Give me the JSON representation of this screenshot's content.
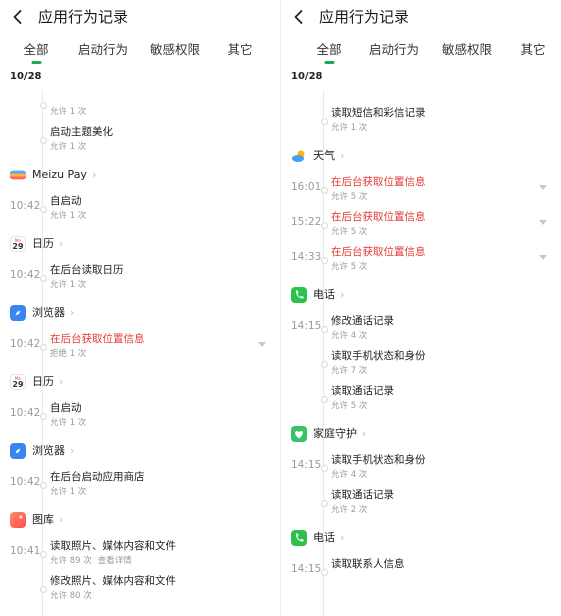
{
  "icons": {
    "back": "back-arrow-icon",
    "expand": "chevron-down-icon",
    "app_chevron": "chevron-right-icon"
  },
  "colors": {
    "accent": "#1aaa55",
    "warning": "#e53935",
    "secondary_text": "#9a9a9a"
  },
  "left": {
    "title": "应用行为记录",
    "tabs": [
      "全部",
      "启动行为",
      "敏感权限",
      "其它"
    ],
    "active_tab": 0,
    "date": "10/28",
    "rows": [
      {
        "kind": "entry",
        "time": "",
        "name": "",
        "sub": "允许 1 次",
        "red": false,
        "expand": false
      },
      {
        "kind": "entry",
        "time": "",
        "name": "启动主题美化",
        "sub": "允许 1 次",
        "red": false,
        "expand": false
      },
      {
        "kind": "app",
        "name": "Meizu Pay",
        "icon": "meizu-pay-icon"
      },
      {
        "kind": "entry",
        "time": "10:42",
        "name": "自启动",
        "sub": "允许 1 次",
        "red": false,
        "expand": false
      },
      {
        "kind": "app",
        "name": "日历",
        "icon": "calendar-icon",
        "cal_day": "29",
        "cal_label": "Mo"
      },
      {
        "kind": "entry",
        "time": "10:42",
        "name": "在后台读取日历",
        "sub": "允许 1 次",
        "red": false,
        "expand": false
      },
      {
        "kind": "app",
        "name": "浏览器",
        "icon": "browser-icon"
      },
      {
        "kind": "entry",
        "time": "10:42",
        "name": "在后台获取位置信息",
        "sub": "拒绝 1 次",
        "red": true,
        "expand": true
      },
      {
        "kind": "app",
        "name": "日历",
        "icon": "calendar-icon",
        "cal_day": "29",
        "cal_label": "Mo"
      },
      {
        "kind": "entry",
        "time": "10:42",
        "name": "自启动",
        "sub": "允许 1 次",
        "red": false,
        "expand": false
      },
      {
        "kind": "app",
        "name": "浏览器",
        "icon": "browser-icon"
      },
      {
        "kind": "entry",
        "time": "10:42",
        "name": "在后台启动应用商店",
        "sub": "允许 1 次",
        "red": false,
        "expand": false
      },
      {
        "kind": "app",
        "name": "图库",
        "icon": "gallery-icon"
      },
      {
        "kind": "entry",
        "time": "10:41",
        "name": "读取照片、媒体内容和文件",
        "sub": "允许 89 次",
        "detail": "查看详情",
        "red": false,
        "expand": false
      },
      {
        "kind": "entry",
        "time": "",
        "name": "修改照片、媒体内容和文件",
        "sub": "允许 80 次",
        "red": false,
        "expand": false
      }
    ]
  },
  "right": {
    "title": "应用行为记录",
    "tabs": [
      "全部",
      "启动行为",
      "敏感权限",
      "其它"
    ],
    "active_tab": 0,
    "date": "10/28",
    "rows": [
      {
        "kind": "entry",
        "time": "",
        "name": "读取短信和彩信记录",
        "sub": "允许 1 次",
        "red": false,
        "expand": false
      },
      {
        "kind": "app",
        "name": "天气",
        "icon": "weather-icon"
      },
      {
        "kind": "entry",
        "time": "16:01",
        "name": "在后台获取位置信息",
        "sub": "允许 5 次",
        "red": true,
        "expand": true
      },
      {
        "kind": "entry",
        "time": "15:22",
        "name": "在后台获取位置信息",
        "sub": "允许 5 次",
        "red": true,
        "expand": true
      },
      {
        "kind": "entry",
        "time": "14:33",
        "name": "在后台获取位置信息",
        "sub": "允许 5 次",
        "red": true,
        "expand": true
      },
      {
        "kind": "app",
        "name": "电话",
        "icon": "phone-icon"
      },
      {
        "kind": "entry",
        "time": "14:15",
        "name": "修改通话记录",
        "sub": "允许 4 次",
        "red": false,
        "expand": false
      },
      {
        "kind": "entry",
        "time": "",
        "name": "读取手机状态和身份",
        "sub": "允许 7 次",
        "red": false,
        "expand": false
      },
      {
        "kind": "entry",
        "time": "",
        "name": "读取通话记录",
        "sub": "允许 5 次",
        "red": false,
        "expand": false
      },
      {
        "kind": "app",
        "name": "家庭守护",
        "icon": "family-guard-icon"
      },
      {
        "kind": "entry",
        "time": "14:15",
        "name": "读取手机状态和身份",
        "sub": "允许 4 次",
        "red": false,
        "expand": false
      },
      {
        "kind": "entry",
        "time": "",
        "name": "读取通话记录",
        "sub": "允许 2 次",
        "red": false,
        "expand": false
      },
      {
        "kind": "app",
        "name": "电话",
        "icon": "phone-icon"
      },
      {
        "kind": "entry",
        "time": "14:15",
        "name": "读取联系人信息",
        "sub": "",
        "red": false,
        "expand": false
      }
    ]
  }
}
